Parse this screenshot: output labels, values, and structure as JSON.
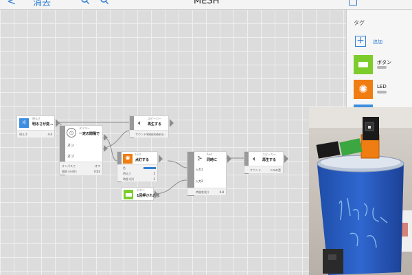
{
  "header": {
    "back_label": "<",
    "erase_label": "消去",
    "title": "MESH"
  },
  "sidebar": {
    "tags_label": "タグ",
    "add_label": "追加",
    "tags": [
      {
        "label": "ボタン",
        "color": "#7ccd2c"
      },
      {
        "label": "LED",
        "color": "#f07d12"
      }
    ]
  },
  "nodes": {
    "brightness": {
      "caption": "明るさ",
      "action": "明るさが変...",
      "row1_label": "明るさ",
      "row1_value": "4-4"
    },
    "timer": {
      "caption": "タイマー",
      "action": "一定の間隔で",
      "on_label": "オン",
      "off_label": "オフ",
      "row1_label": "オンパスで",
      "row1_value": "オフ",
      "row2_label": "間隔 (分/秒)",
      "row2_value": "0:02"
    },
    "speaker1": {
      "caption": "スピーカー",
      "action": "再生する",
      "row1_label": "サウンド",
      "row1_value": "Babababaka..."
    },
    "led": {
      "caption": "LED",
      "action": "点灯する",
      "row1_label": "色",
      "row2_label": "明るさ",
      "row2_value": "5",
      "row3_label": "時間 (秒)",
      "row3_value": "2"
    },
    "button": {
      "caption": "ボタン",
      "action": "1回押されたら"
    },
    "and": {
      "caption": "And",
      "action": "同時に",
      "in1_label": "入力1",
      "in2_label": "入力2",
      "row1_label": "時間差(秒)",
      "row1_value": "0.8"
    },
    "speaker2": {
      "caption": "スピーカー",
      "action": "再生する",
      "row1_label": "サウンド",
      "row1_value": "ベルの音"
    }
  },
  "colors": {
    "accent": "#2f7fd6",
    "brightness_icon": "#3d8ee0",
    "led_icon": "#f07d12",
    "button_icon": "#7ccd2c",
    "photo_tag_green": "#3ca640",
    "photo_tag_orange": "#f07d12",
    "cylinder_blue": "#2a5fc4"
  },
  "photo": {
    "handwriting": "リズムゲーム"
  }
}
